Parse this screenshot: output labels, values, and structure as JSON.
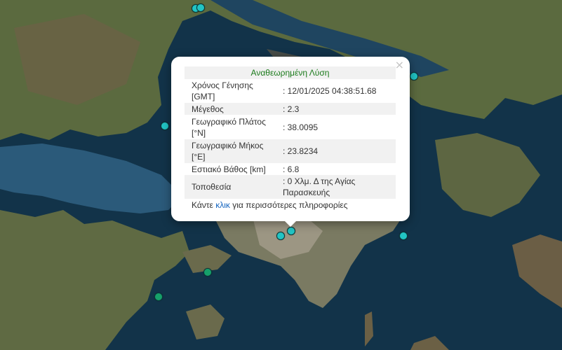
{
  "popup": {
    "title": "Αναθεωρημένη Λύση",
    "close_symbol": "×",
    "rows": [
      {
        "label": "Χρόνος Γένησης [GMT]",
        "value": ": 12/01/2025 04:38:51.68"
      },
      {
        "label": "Μέγεθος",
        "value": ": 2.3"
      },
      {
        "label": "Γεωγραφικό Πλάτος [°N]",
        "value": ": 38.0095"
      },
      {
        "label": "Γεωγραφικό Μήκος [°E]",
        "value": ": 23.8234"
      },
      {
        "label": "Εστιακό Βάθος [km]",
        "value": ": 6.8"
      },
      {
        "label": "Τοποθεσία",
        "value": ": 0 Χλμ. Δ της Αγίας Παρασκευής"
      }
    ],
    "footer_before": "Κάντε ",
    "footer_link": "κλικ",
    "footer_after": " για περισσότερες πληροφορίες"
  },
  "colors": {
    "marker_cyan": "#22c4c4",
    "marker_green": "#16a06a",
    "title_green": "#1a7a1a",
    "link_blue": "#1565c0"
  }
}
